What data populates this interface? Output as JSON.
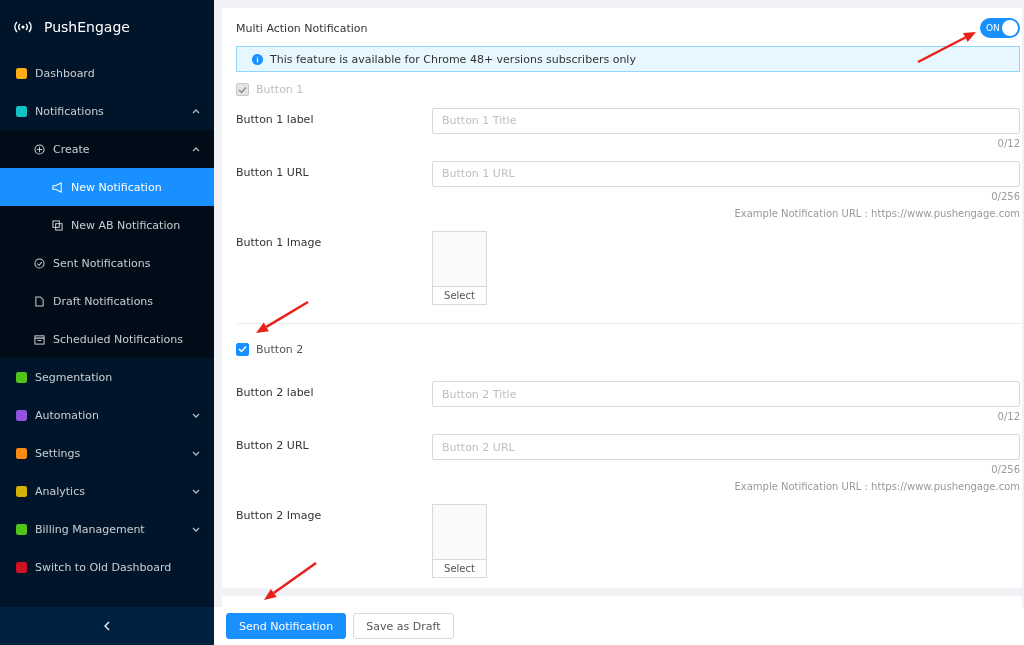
{
  "sidebar": {
    "brand": "PushEngage",
    "items": [
      {
        "label": "Dashboard",
        "selected": false
      },
      {
        "label": "Notifications",
        "selected": false,
        "expanded": true,
        "children": [
          {
            "label": "Create",
            "selected": false,
            "expanded": true,
            "children": [
              {
                "label": "New Notification",
                "selected": true
              },
              {
                "label": "New AB Notification",
                "selected": false
              }
            ]
          },
          {
            "label": "Sent Notifications",
            "selected": false
          },
          {
            "label": "Draft Notifications",
            "selected": false
          },
          {
            "label": "Scheduled Notifications",
            "selected": false
          }
        ]
      },
      {
        "label": "Segmentation",
        "selected": false
      },
      {
        "label": "Automation",
        "selected": false,
        "expanded": false
      },
      {
        "label": "Settings",
        "selected": false,
        "expanded": false
      },
      {
        "label": "Analytics",
        "selected": false,
        "expanded": false
      },
      {
        "label": "Billing Management",
        "selected": false,
        "expanded": false
      },
      {
        "label": "Switch to Old Dashboard",
        "selected": false
      }
    ]
  },
  "multi_action": {
    "title": "Multi Action Notification",
    "toggle": {
      "label": "ON",
      "on": true
    },
    "alert": "This feature is available for Chrome 48+ versions subscribers only",
    "buttons": [
      {
        "label": "Button 1",
        "checked": true,
        "disabled": true,
        "fields": [
          {
            "label": "Button 1 label",
            "placeholder": "Button 1 Title",
            "counter": "0/12"
          },
          {
            "label": "Button 1 URL",
            "placeholder": "Button 1 URL",
            "counter": "0/256",
            "hint": "Example Notification URL : https://www.pushengage.com"
          }
        ],
        "image": {
          "label": "Button 1 Image",
          "action": "Select"
        }
      },
      {
        "label": "Button 2",
        "checked": true,
        "disabled": false,
        "fields": [
          {
            "label": "Button 2 label",
            "placeholder": "Button 2 Title",
            "counter": "0/12"
          },
          {
            "label": "Button 2 URL",
            "placeholder": "Button 2 URL",
            "counter": "0/256",
            "hint": "Example Notification URL : https://www.pushengage.com"
          }
        ],
        "image": {
          "label": "Button 2 Image",
          "action": "Select"
        }
      }
    ]
  },
  "footer": {
    "buttons": [
      {
        "label": "Send Notification",
        "kind": "primary"
      },
      {
        "label": "Save as Draft",
        "kind": "default"
      }
    ]
  }
}
